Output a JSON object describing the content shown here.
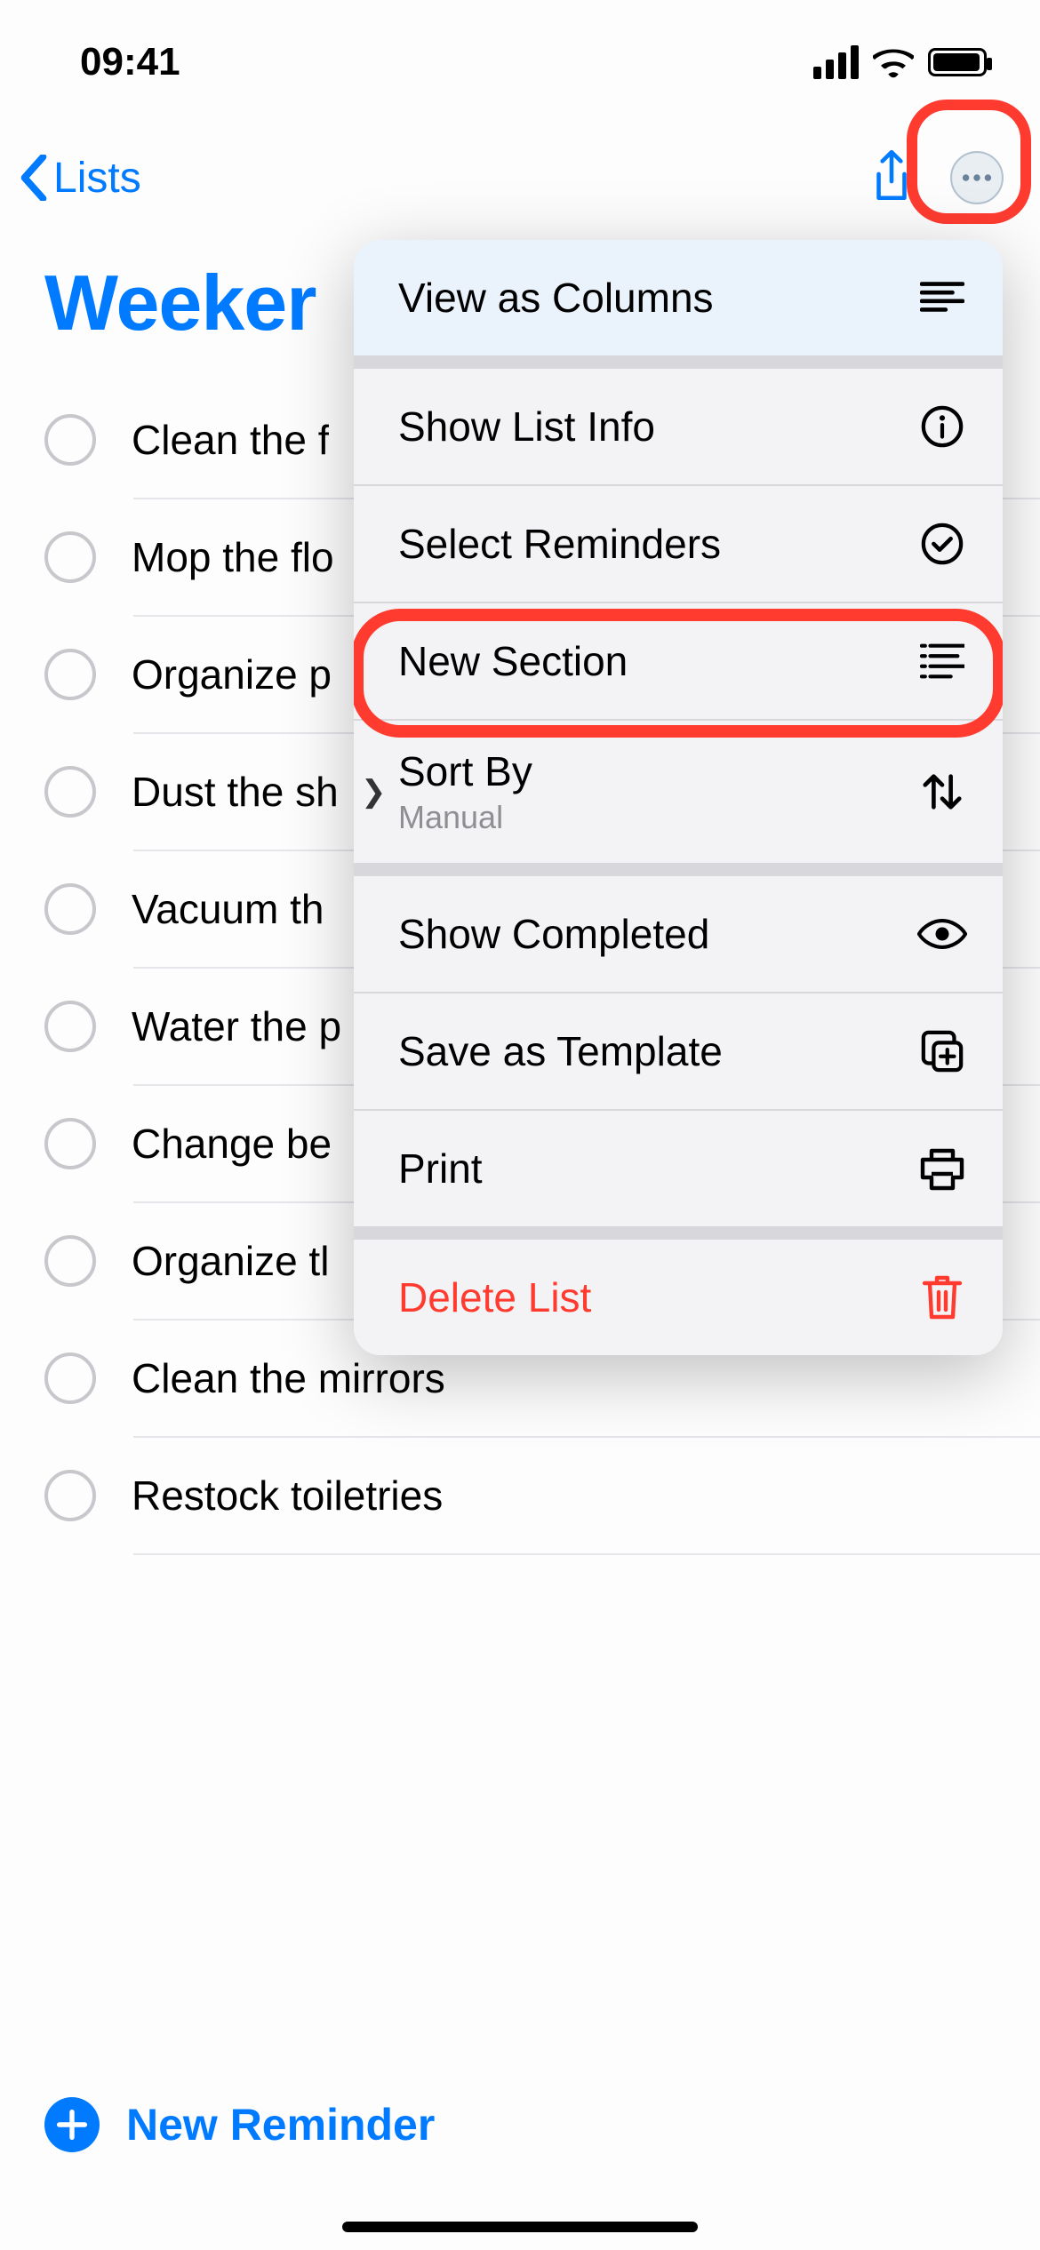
{
  "status": {
    "time": "09:41"
  },
  "nav": {
    "back_label": "Lists"
  },
  "list": {
    "title": "Weeker"
  },
  "reminders": [
    {
      "label": "Clean the f"
    },
    {
      "label": "Mop the flo"
    },
    {
      "label": "Organize p"
    },
    {
      "label": "Dust the sh"
    },
    {
      "label": "Vacuum th"
    },
    {
      "label": "Water the p"
    },
    {
      "label": "Change be"
    },
    {
      "label": "Organize tl"
    },
    {
      "label": "Clean the mirrors"
    },
    {
      "label": "Restock toiletries"
    }
  ],
  "menu": {
    "view_as_columns": "View as Columns",
    "show_list_info": "Show List Info",
    "select_reminders": "Select Reminders",
    "new_section": "New Section",
    "sort_by": "Sort By",
    "sort_by_value": "Manual",
    "show_completed": "Show Completed",
    "save_as_template": "Save as Template",
    "print": "Print",
    "delete_list": "Delete List"
  },
  "footer": {
    "new_reminder": "New Reminder"
  }
}
